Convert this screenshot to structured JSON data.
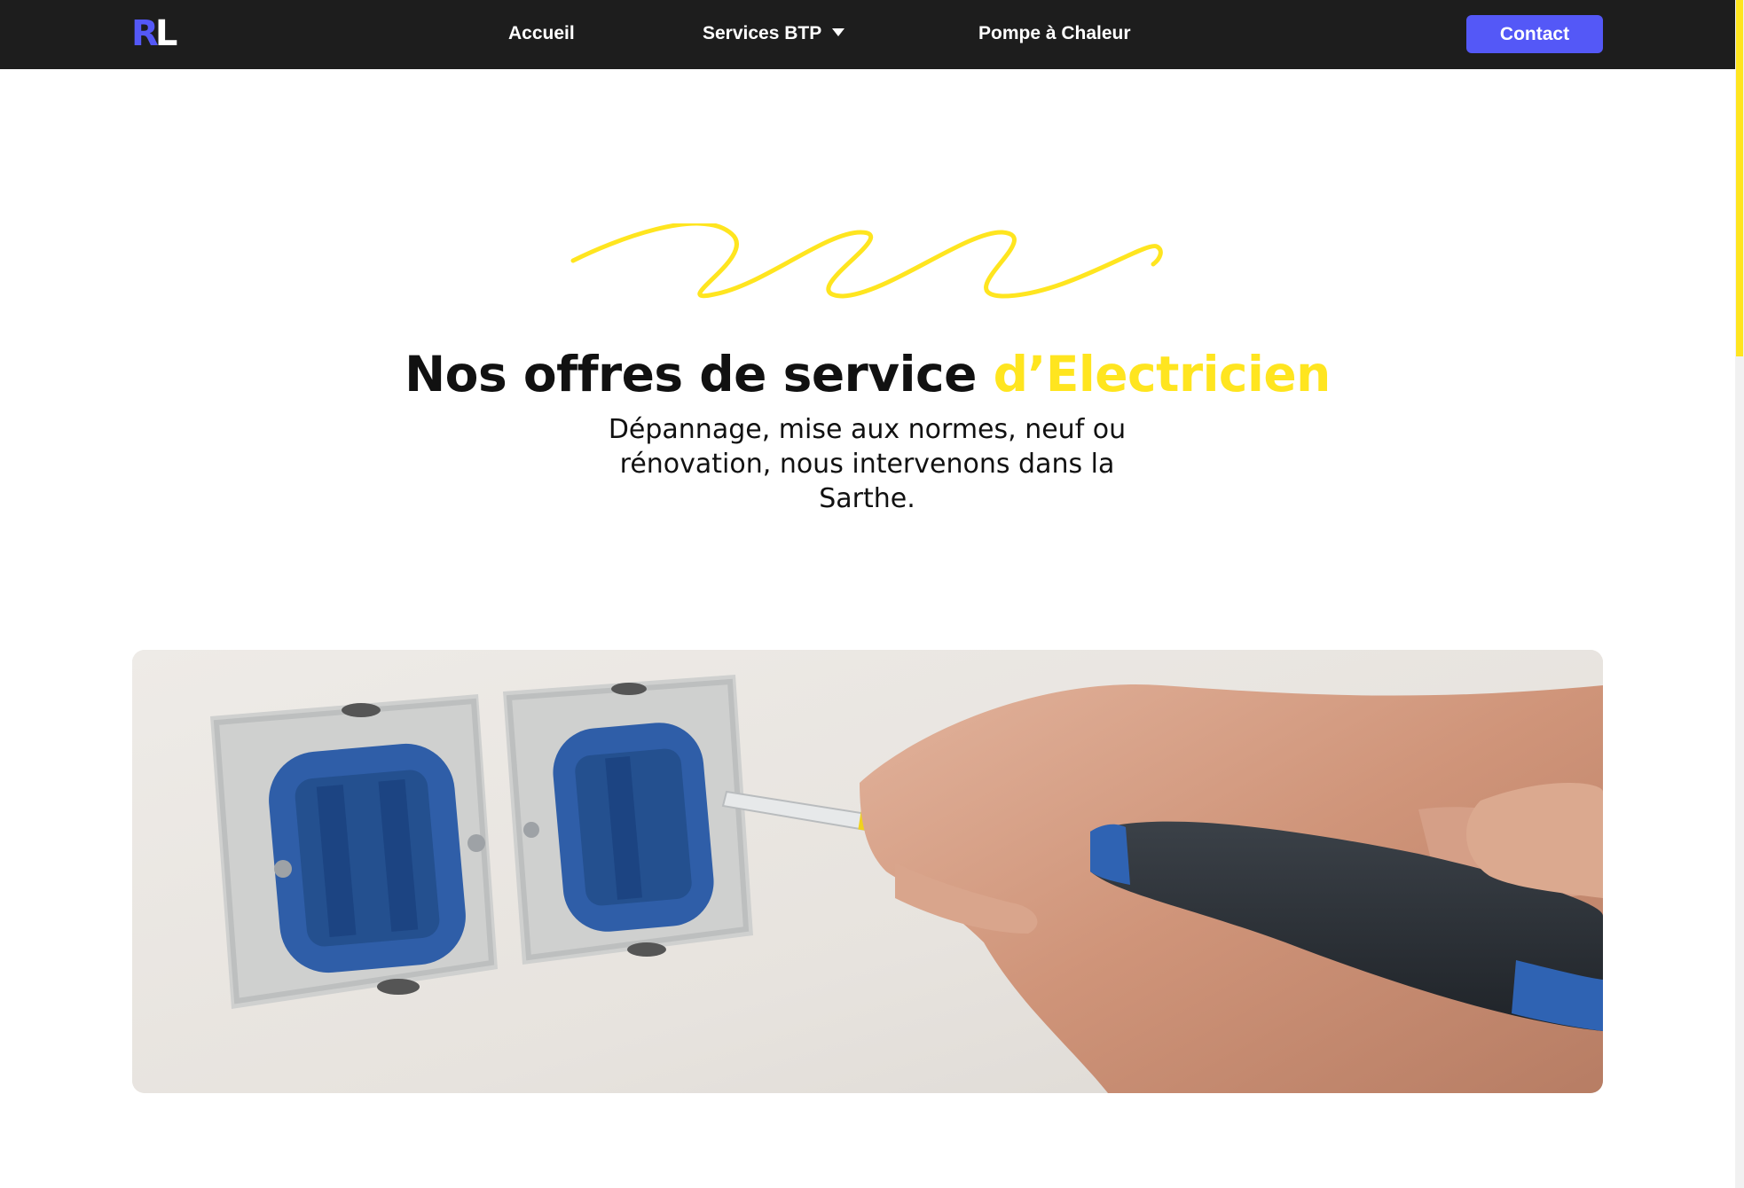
{
  "header": {
    "logo": {
      "letter1": "R",
      "letter2": "L"
    },
    "nav": [
      {
        "label": "Accueil"
      },
      {
        "label": "Services BTP",
        "has_dropdown": true
      },
      {
        "label": "Pompe à Chaleur"
      }
    ],
    "contact_label": "Contact"
  },
  "hero": {
    "title_main": "Nos offres de service ",
    "title_accent": "d’Electricien",
    "subtitle": "Dépannage, mise aux normes, neuf ou rénovation, nous intervenons dans la Sarthe."
  },
  "colors": {
    "navbar_bg": "#1d1d1d",
    "brand_blue": "#5458f7",
    "accent_yellow": "#ffe51f",
    "text_dark": "#111111"
  },
  "icons": {
    "dropdown": "caret-down-icon",
    "decoration": "squiggle-line"
  },
  "image": {
    "subject": "electrician-hand-screwdriver-wall-sockets"
  }
}
